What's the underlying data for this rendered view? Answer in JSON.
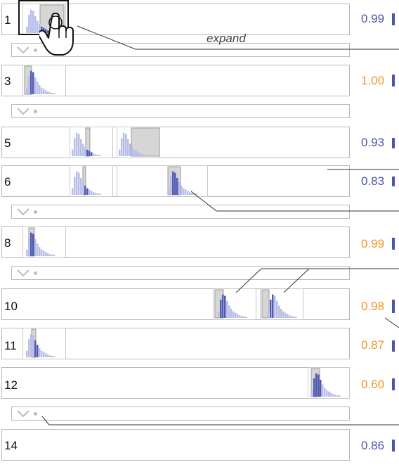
{
  "colors": {
    "blue": "#4a56a8",
    "orange": "#f0962a",
    "bar_light": "#b7bde6",
    "bar_dark": "#4e5ab0",
    "highlight": "#d6d6d6"
  },
  "annotation": {
    "expand_label": "expand"
  },
  "rows": [
    {
      "id": "1",
      "score": "0.99",
      "color": "blue"
    },
    {
      "id": "3",
      "score": "1.00",
      "color": "orange"
    },
    {
      "id": "5",
      "score": "0.93",
      "color": "blue"
    },
    {
      "id": "6",
      "score": "0.83",
      "color": "blue"
    },
    {
      "id": "8",
      "score": "0.99",
      "color": "orange"
    },
    {
      "id": "10",
      "score": "0.98",
      "color": "orange"
    },
    {
      "id": "11",
      "score": "0.87",
      "color": "orange"
    },
    {
      "id": "12",
      "score": "0.60",
      "color": "orange"
    },
    {
      "id": "14",
      "score": "0.86",
      "color": "blue"
    }
  ],
  "icons": {
    "expand": "chevron-down-icon",
    "pointer": "hand-pointer-icon"
  }
}
